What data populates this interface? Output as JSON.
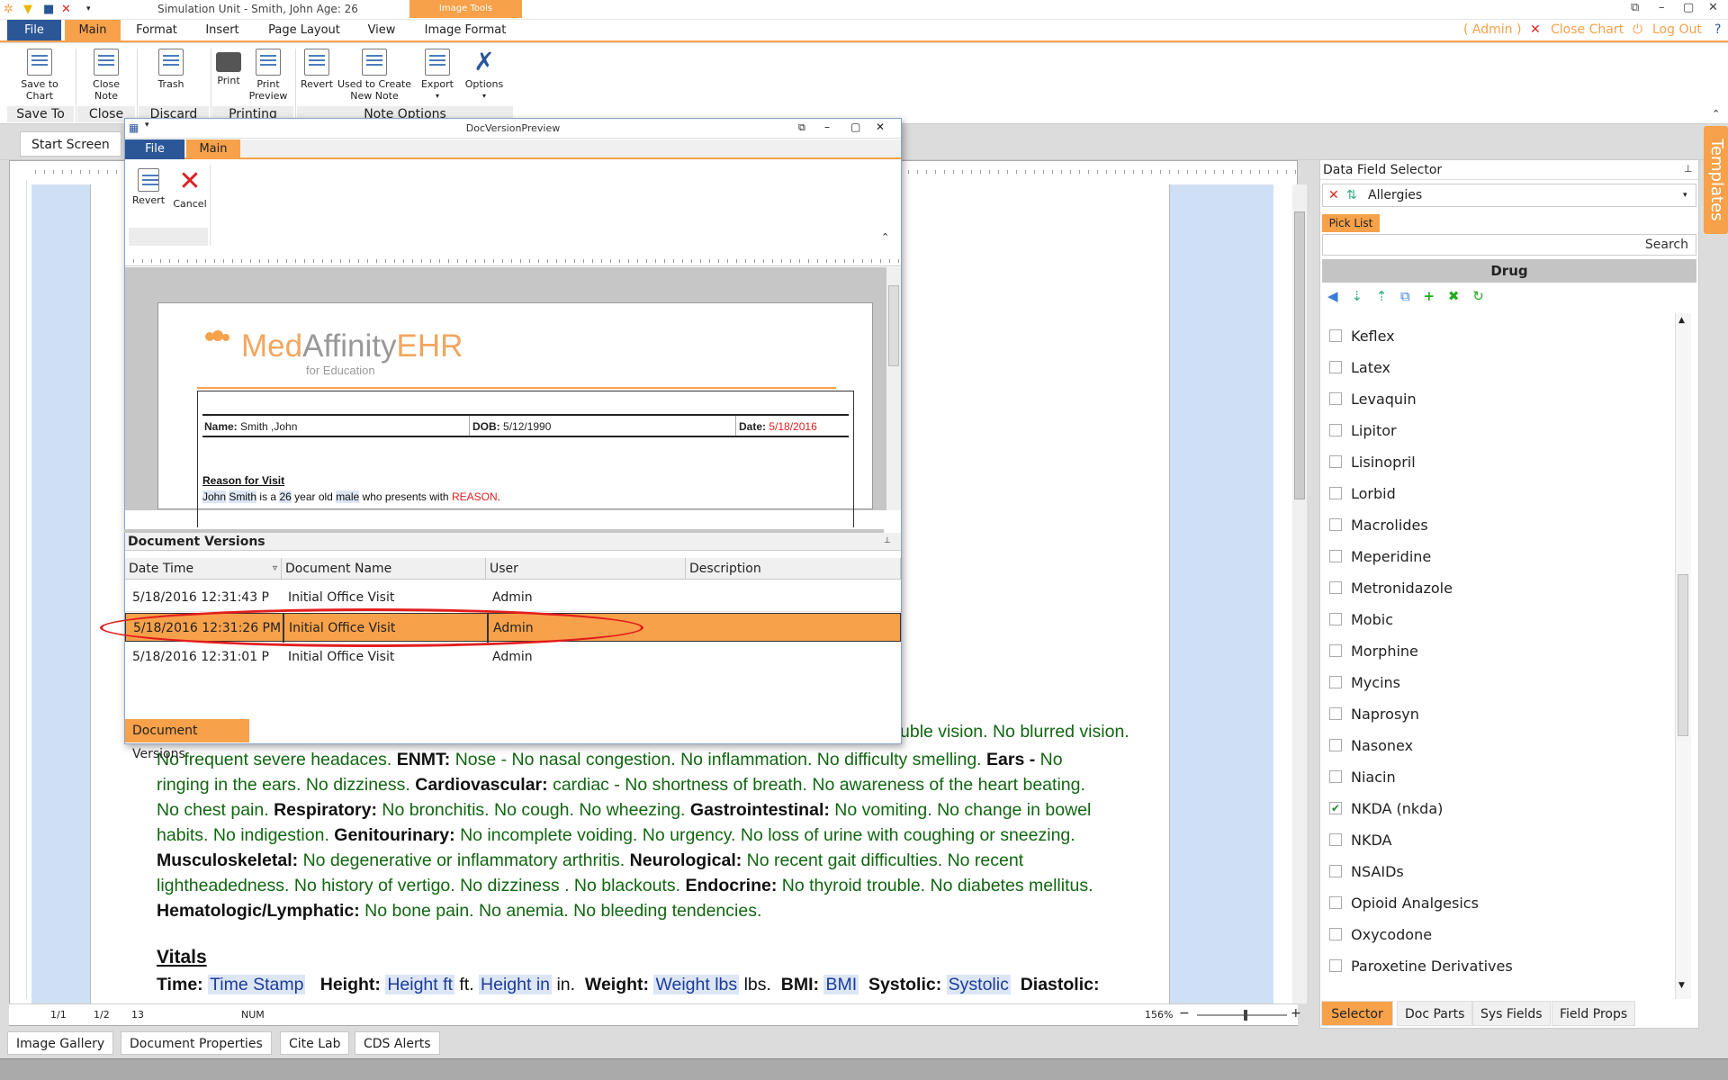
{
  "app": {
    "title": "Simulation Unit - Smith, John Age: 26",
    "image_tools": "Image Tools",
    "menu": [
      "File",
      "Main",
      "Format",
      "Insert",
      "Page Layout",
      "View",
      "Image Format"
    ],
    "user": "( Admin )",
    "close_chart": "Close Chart",
    "log_out": "Log Out"
  },
  "ribbon": {
    "buttons": [
      {
        "label": "Save to Chart",
        "icon": "save-to-chart-icon"
      },
      {
        "label": "Close Note",
        "icon": "close-note-icon"
      },
      {
        "label": "Trash",
        "icon": "trash-icon"
      },
      {
        "label": "Print",
        "icon": "printer-icon"
      },
      {
        "label": "Print Preview",
        "icon": "print-preview-icon"
      },
      {
        "label": "Revert",
        "icon": "revert-icon"
      },
      {
        "label": "Used to Create New Note",
        "icon": "new-note-icon"
      },
      {
        "label": "Export",
        "icon": "export-icon"
      },
      {
        "label": "Options",
        "icon": "tools-icon"
      }
    ],
    "groups": [
      "Save To",
      "Close",
      "Discard",
      "Printing",
      "Note Options"
    ]
  },
  "tabs": {
    "start_screen": "Start Screen"
  },
  "popup": {
    "title": "DocVersionPreview",
    "menu": [
      "File",
      "Main"
    ],
    "buttons": [
      {
        "label": "Revert",
        "icon": "revert-icon"
      },
      {
        "label": "Cancel",
        "icon": "cancel-x-icon"
      }
    ],
    "logo_a": "Med",
    "logo_b": "Affinity",
    "logo_c": "EHR",
    "logo_sub": "for Education",
    "name_label": "Name:",
    "name_value": "Smith ,John",
    "dob_label": "DOB:",
    "dob_value": "5/12/1990",
    "date_label": "Date:",
    "date_value": "5/18/2016",
    "reason_heading": "Reason for Visit",
    "reason": {
      "first": "John",
      "last": "Smith",
      "is_a": "is a",
      "age": "26",
      "year_old": "year old",
      "sex": "male",
      "presents": "who presents with",
      "reason": "REASON",
      "end": "."
    },
    "versions_header": "Document Versions",
    "columns": [
      "Date Time",
      "Document Name",
      "User",
      "Description"
    ],
    "rows": [
      {
        "datetime": "5/18/2016 12:31:43 P",
        "name": "Initial Office Visit",
        "user": "Admin",
        "desc": ""
      },
      {
        "datetime": "5/18/2016 12:31:26 PM",
        "name": "Initial Office Visit",
        "user": "Admin",
        "desc": ""
      },
      {
        "datetime": "5/18/2016 12:31:01 P",
        "name": "Initial Office Visit",
        "user": "Admin",
        "desc": ""
      }
    ],
    "bottom_tab": "Document Versions"
  },
  "document": {
    "partial_first_line": "uble vision. No blurred vision.",
    "l1a": "No frequent severe headaces.",
    "l1b": "ENMT:",
    "l1c": "Nose -  No nasal congestion. No inflammation. No difficulty smelling.",
    "l1d": "Ears -",
    "l1e": "No",
    "l2a": "ringing in the ears. No dizziness.",
    "l2b": "Cardiovascular:",
    "l2c": "cardiac -  No shortness of breath. No awareness of the heart beating.",
    "l3a": "No chest pain.",
    "l3b": "Respiratory:",
    "l3c": "No bronchitis. No  cough. No wheezing.",
    "l3d": "Gastrointestinal:",
    "l3e": "No vomiting. No change in bowel",
    "l4a": "habits. No indigestion.",
    "l4b": "Genitourinary:",
    "l4c": "No incomplete voiding. No urgency. No loss of urine with coughing or sneezing.",
    "l5a": "Musculoskeletal:",
    "l5b": "No degenerative or inflammatory arthritis.",
    "l5c": "Neurological:",
    "l5d": "No recent gait difficulties. No recent",
    "l6a": "lightheadedness. No history of vertigo. No dizziness . No blackouts.",
    "l6b": "Endocrine:",
    "l6c": "No thyroid trouble. No diabetes mellitus.",
    "l7a": "Hematologic/Lymphatic:",
    "l7b": "No bone pain. No anemia. No bleeding tendencies.",
    "vitals_heading": "Vitals",
    "v_time": "Time:",
    "v_time_f": "Time Stamp",
    "v_height": "Height:",
    "v_height_ft": "Height ft",
    "v_ft": "ft.",
    "v_height_in": "Height in",
    "v_in": "in.",
    "v_weight": "Weight:",
    "v_weight_f": "Weight lbs",
    "v_lbs": "lbs.",
    "v_bmi": "BMI:",
    "v_bmi_f": "BMI",
    "v_sys": "Systolic:",
    "v_sys_f": "Systolic",
    "v_dia": "Diastolic:"
  },
  "status": {
    "p1": "1/1",
    "p2": "1/2",
    "p3": "13",
    "num": "NUM",
    "zoom": "156%"
  },
  "bottom_tabs": [
    "Image Gallery",
    "Document Properties",
    "Cite Lab",
    "CDS Alerts"
  ],
  "right_panel": {
    "title": "Data Field Selector",
    "combo": "Allergies",
    "pick_list": "Pick List",
    "search": "Search",
    "drug_header": "Drug",
    "items": [
      {
        "label": "Keflex",
        "checked": false
      },
      {
        "label": "Latex",
        "checked": false
      },
      {
        "label": "Levaquin",
        "checked": false
      },
      {
        "label": "Lipitor",
        "checked": false
      },
      {
        "label": "Lisinopril",
        "checked": false
      },
      {
        "label": "Lorbid",
        "checked": false
      },
      {
        "label": "Macrolides",
        "checked": false
      },
      {
        "label": "Meperidine",
        "checked": false
      },
      {
        "label": "Metronidazole",
        "checked": false
      },
      {
        "label": "Mobic",
        "checked": false
      },
      {
        "label": "Morphine",
        "checked": false
      },
      {
        "label": "Mycins",
        "checked": false
      },
      {
        "label": "Naprosyn",
        "checked": false
      },
      {
        "label": "Nasonex",
        "checked": false
      },
      {
        "label": "Niacin",
        "checked": false
      },
      {
        "label": "NKDA (nkda)",
        "checked": true
      },
      {
        "label": "NKDA",
        "checked": false
      },
      {
        "label": "NSAIDs",
        "checked": false
      },
      {
        "label": "Opioid Analgesics",
        "checked": false
      },
      {
        "label": "Oxycodone",
        "checked": false
      },
      {
        "label": "Paroxetine Derivatives",
        "checked": false
      }
    ],
    "tabs": [
      "Selector",
      "Doc Parts",
      "Sys Fields",
      "Field Props"
    ],
    "templates": "Templates"
  },
  "colors": {
    "accent": "#f7a14a",
    "file_blue": "#2b5797",
    "highlight_red": "#e31d1d",
    "text_green": "#116611"
  }
}
